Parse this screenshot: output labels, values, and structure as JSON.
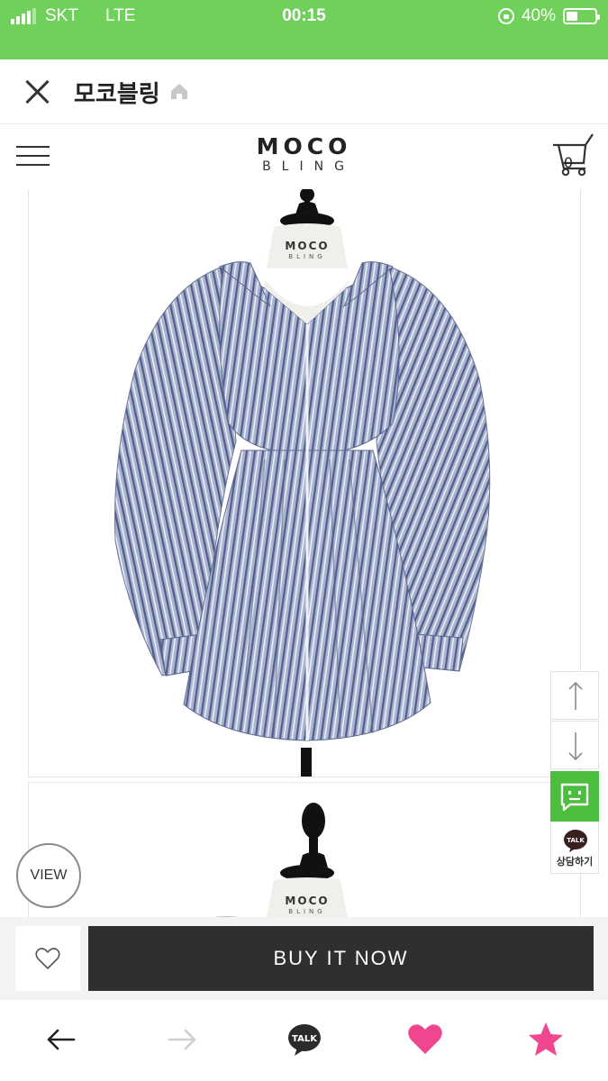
{
  "status_bar": {
    "carrier": "SKT",
    "network": "LTE",
    "time": "00:15",
    "battery": "40%",
    "battery_level": 0.4
  },
  "app_bar": {
    "title": "모코블링",
    "close_icon": "close-icon",
    "home_icon": "home-icon"
  },
  "shop_header": {
    "menu_icon": "hamburger-icon",
    "logo_line1": "MOCO",
    "logo_line2": "BLING",
    "cart_count": "0"
  },
  "product": {
    "mannequin_logo_line1": "MOCO",
    "mannequin_logo_line2": "BLING"
  },
  "floating": {
    "scroll_up_icon": "arrow-up-icon",
    "scroll_down_icon": "arrow-down-icon",
    "chat_icon": "chat-icon",
    "talk_badge": "TALK",
    "talk_label": "상담하기"
  },
  "view_button": "VIEW",
  "buy_bar": {
    "wish_icon": "heart-outline-icon",
    "buy_label": "BUY IT NOW"
  },
  "bottom_nav": {
    "back_icon": "arrow-left-icon",
    "forward_icon": "arrow-right-icon",
    "talk_label": "TALK",
    "heart_icon": "heart-icon",
    "star_icon": "star-icon",
    "accent_heart": "#f0458f",
    "accent_star": "#f0458f"
  },
  "colors": {
    "status_bar": "#6fd05a",
    "chat_green": "#4cbd3c",
    "buy_button": "#2f2f2f"
  }
}
